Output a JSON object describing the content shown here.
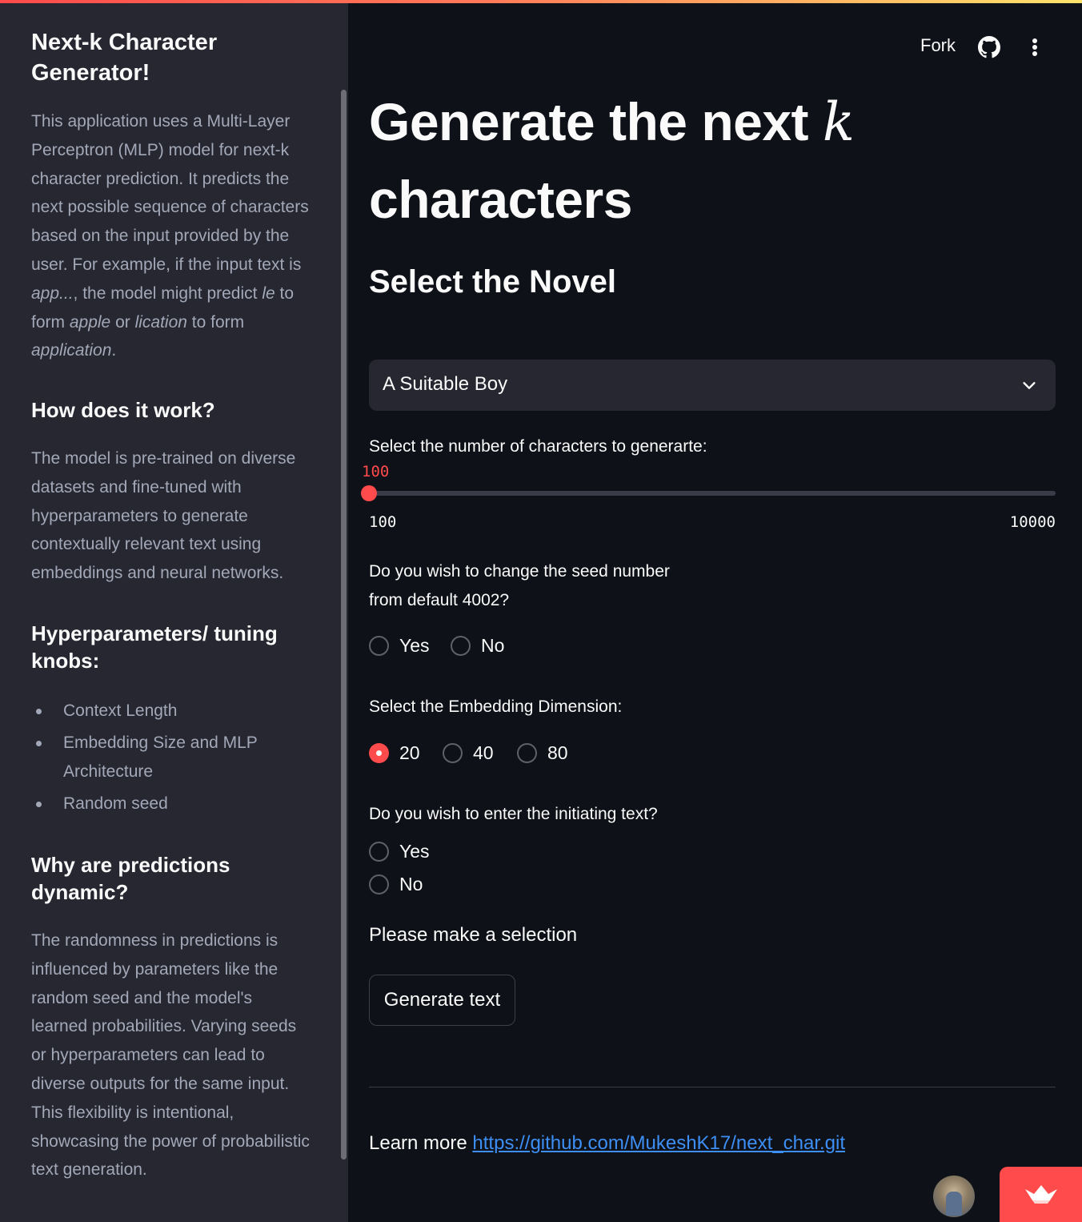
{
  "sidebar": {
    "title": "Next-k Character Generator!",
    "intro": {
      "p1": "This application uses a Multi-Layer Perceptron (MLP) model for next-k character prediction. It predicts the next possible sequence of characters based on the input provided by the user. For example, if the input text is ",
      "e1": "app...",
      "p2": ", the model might predict ",
      "e2": "le",
      "p3": " to form ",
      "e3": "apple",
      "p4": " or ",
      "e4": "lication",
      "p5": " to form ",
      "e5": "application",
      "p6": "."
    },
    "how_heading": "How does it work?",
    "how_text": "The model is pre-trained on diverse datasets and fine-tuned with hyperparameters to generate contextually relevant text using embeddings and neural networks.",
    "hyper_heading": "Hyperparameters/ tuning knobs:",
    "hyper_items": [
      "Context Length",
      "Embedding Size and MLP Architecture",
      "Random seed"
    ],
    "why_heading": "Why are predictions dynamic?",
    "why_text": "The randomness in predictions is influenced by parameters like the random seed and the model's learned probabilities. Varying seeds or hyperparameters can lead to diverse outputs for the same input. This flexibility is intentional, showcasing the power of probabilistic text generation."
  },
  "header": {
    "fork_label": "Fork",
    "github_icon": "github-icon",
    "menu_icon": "more-vertical-icon"
  },
  "main": {
    "title_text": "Generate the next ",
    "title_var": "k",
    "title_line2": "characters",
    "subtitle": "Select the Novel",
    "novel_select": {
      "value": "A Suitable Boy"
    },
    "chars_slider": {
      "label": "Select the number of characters to generarte:",
      "value": "100",
      "min": "100",
      "max": "10000",
      "fraction": 0.0
    },
    "seed_question": {
      "line1": "Do you wish to change the seed number",
      "line2": "from default 4002?"
    },
    "seed_options": [
      "Yes",
      "No"
    ],
    "embed_label": "Select the Embedding Dimension:",
    "embed_options": [
      "20",
      "40",
      "80"
    ],
    "embed_selected": "20",
    "init_label": "Do you wish to enter the initiating text?",
    "init_options": [
      "Yes",
      "No"
    ],
    "notice": "Please make a selection",
    "generate_button": "Generate text",
    "learn_more": "Learn more ",
    "learn_link": "https://github.com/MukeshK17/next_char.git"
  },
  "colors": {
    "accent": "#ff4b4b",
    "link": "#3d8ff5",
    "sidebar_bg": "#262730",
    "main_bg": "#0e1117"
  }
}
